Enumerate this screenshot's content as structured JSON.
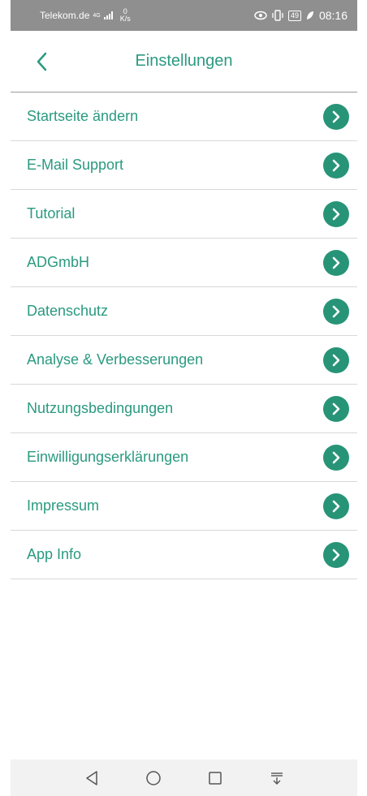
{
  "status_bar": {
    "carrier": "Telekom.de",
    "network": "4G",
    "speed_value": "0",
    "speed_unit": "K/s",
    "battery": "49",
    "time": "08:16"
  },
  "header": {
    "title": "Einstellungen",
    "back_icon": "chevron-left-icon"
  },
  "settings": {
    "items": [
      {
        "label": "Startseite ändern"
      },
      {
        "label": "E-Mail Support"
      },
      {
        "label": "Tutorial"
      },
      {
        "label": "ADGmbH"
      },
      {
        "label": "Datenschutz"
      },
      {
        "label": "Analyse & Verbesserungen"
      },
      {
        "label": "Nutzungsbedingungen"
      },
      {
        "label": "Einwilligungserklärungen"
      },
      {
        "label": "Impressum"
      },
      {
        "label": "App Info"
      }
    ],
    "chevron_icon": "chevron-right-circle-icon"
  },
  "colors": {
    "accent": "#2a9a80",
    "chevron_bg": "#279477",
    "status_bar_bg": "#8f8f8f",
    "nav_bar_bg": "#f2f2f2"
  },
  "nav_bar": {
    "icons": [
      "back-triangle-icon",
      "home-circle-icon",
      "recents-square-icon",
      "notification-pull-icon"
    ]
  }
}
